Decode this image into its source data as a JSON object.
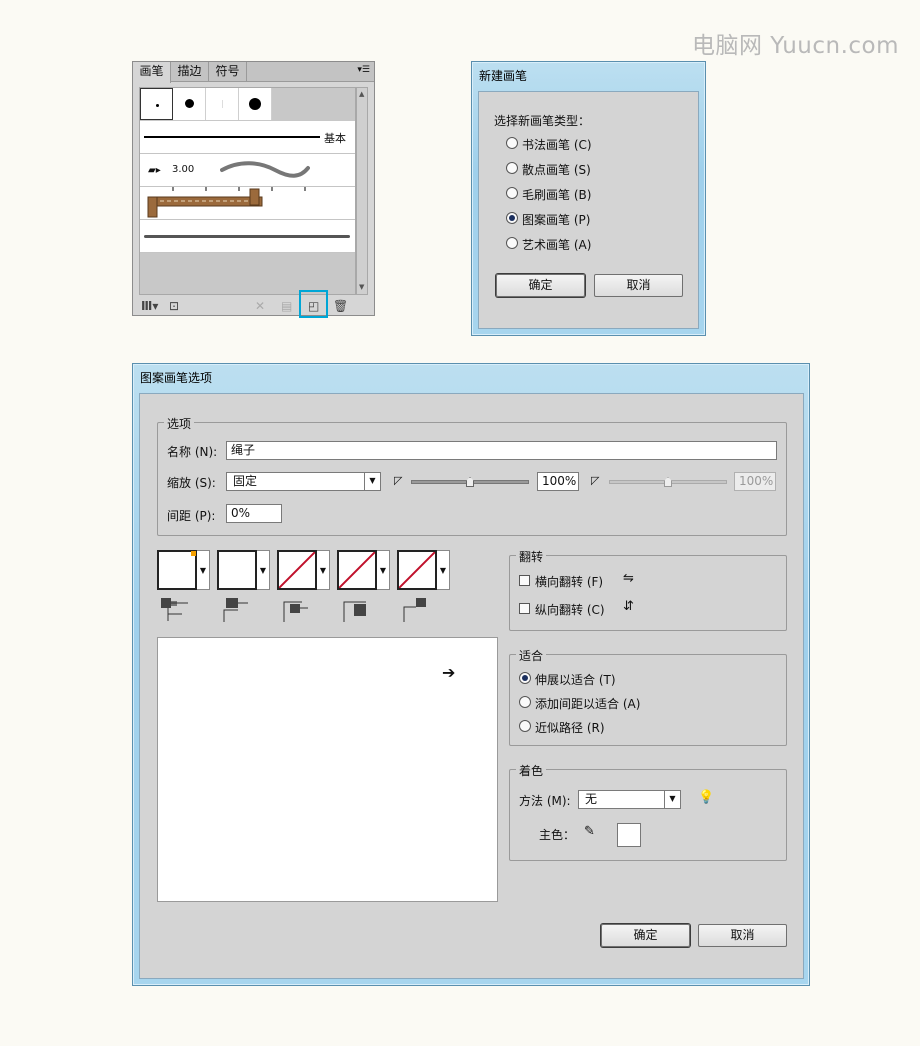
{
  "watermark": "电脑网 Yuucn.com",
  "brushes_panel": {
    "tabs": [
      "画笔",
      "描边",
      "符号"
    ],
    "basic_label": "基本",
    "size_value": "3.00",
    "menu_icon": "panel-menu-icon",
    "footer_icons": [
      "brush-library-icon",
      "libraries-icon",
      "remove-stroke-icon",
      "options-icon",
      "new-brush-icon",
      "delete-icon"
    ]
  },
  "new_brush_dialog": {
    "title": "新建画笔",
    "prompt": "选择新画笔类型：",
    "options": [
      "书法画笔 (C)",
      "散点画笔 (S)",
      "毛刷画笔 (B)",
      "图案画笔 (P)",
      "艺术画笔 (A)"
    ],
    "selected_index": 3,
    "ok": "确定",
    "cancel": "取消"
  },
  "pattern_dialog": {
    "title": "图案画笔选项",
    "options_group": "选项",
    "name_label": "名称 (N):",
    "name_value": "绳子",
    "scale_label": "缩放 (S):",
    "scale_mode": "固定",
    "scale_value": "100%",
    "scale_value2": "100%",
    "spacing_label": "间距 (P):",
    "spacing_value": "0%",
    "flip_group": "翻转",
    "flip_h": "横向翻转 (F)",
    "flip_v": "纵向翻转 (C)",
    "fit_group": "适合",
    "fit_options": [
      "伸展以适合 (T)",
      "添加间距以适合 (A)",
      "近似路径 (R)"
    ],
    "fit_selected": 0,
    "color_group": "着色",
    "method_label": "方法 (M):",
    "method_value": "无",
    "key_color_label": "主色：",
    "ok": "确定",
    "cancel": "取消",
    "colors": {
      "accent": "#00a6d6",
      "slash": "#c0112b",
      "title_bar": "#a6d4ee"
    }
  }
}
